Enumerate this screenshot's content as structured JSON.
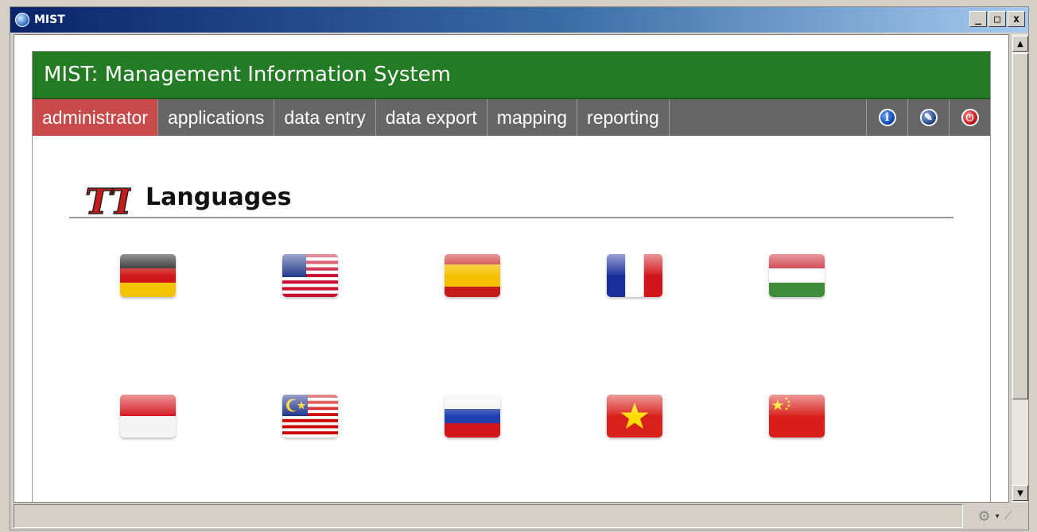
{
  "window": {
    "title": "MIST",
    "minimize": "_",
    "maximize": "□",
    "close": "x"
  },
  "app": {
    "header_title": "MIST: Management Information System"
  },
  "nav": {
    "items": [
      {
        "label": "administrator",
        "active": true
      },
      {
        "label": "applications"
      },
      {
        "label": "data entry"
      },
      {
        "label": "data export"
      },
      {
        "label": "mapping"
      },
      {
        "label": "reporting"
      }
    ],
    "tools": [
      {
        "icon": "info-icon",
        "glyph": "i"
      },
      {
        "icon": "edit-icon",
        "glyph": "✎"
      },
      {
        "icon": "power-icon",
        "glyph": "⏻"
      }
    ]
  },
  "section": {
    "title": "Languages",
    "logo_text": "TT"
  },
  "languages": [
    "German",
    "English (US)",
    "Spanish",
    "French",
    "Hungarian",
    "Indonesian",
    "Malay",
    "Russian",
    "Vietnamese",
    "Chinese"
  ],
  "colors": {
    "header_green": "#237b23",
    "nav_gray": "#666666",
    "nav_active": "#c94a4a"
  },
  "statusbar": {
    "text": ""
  }
}
